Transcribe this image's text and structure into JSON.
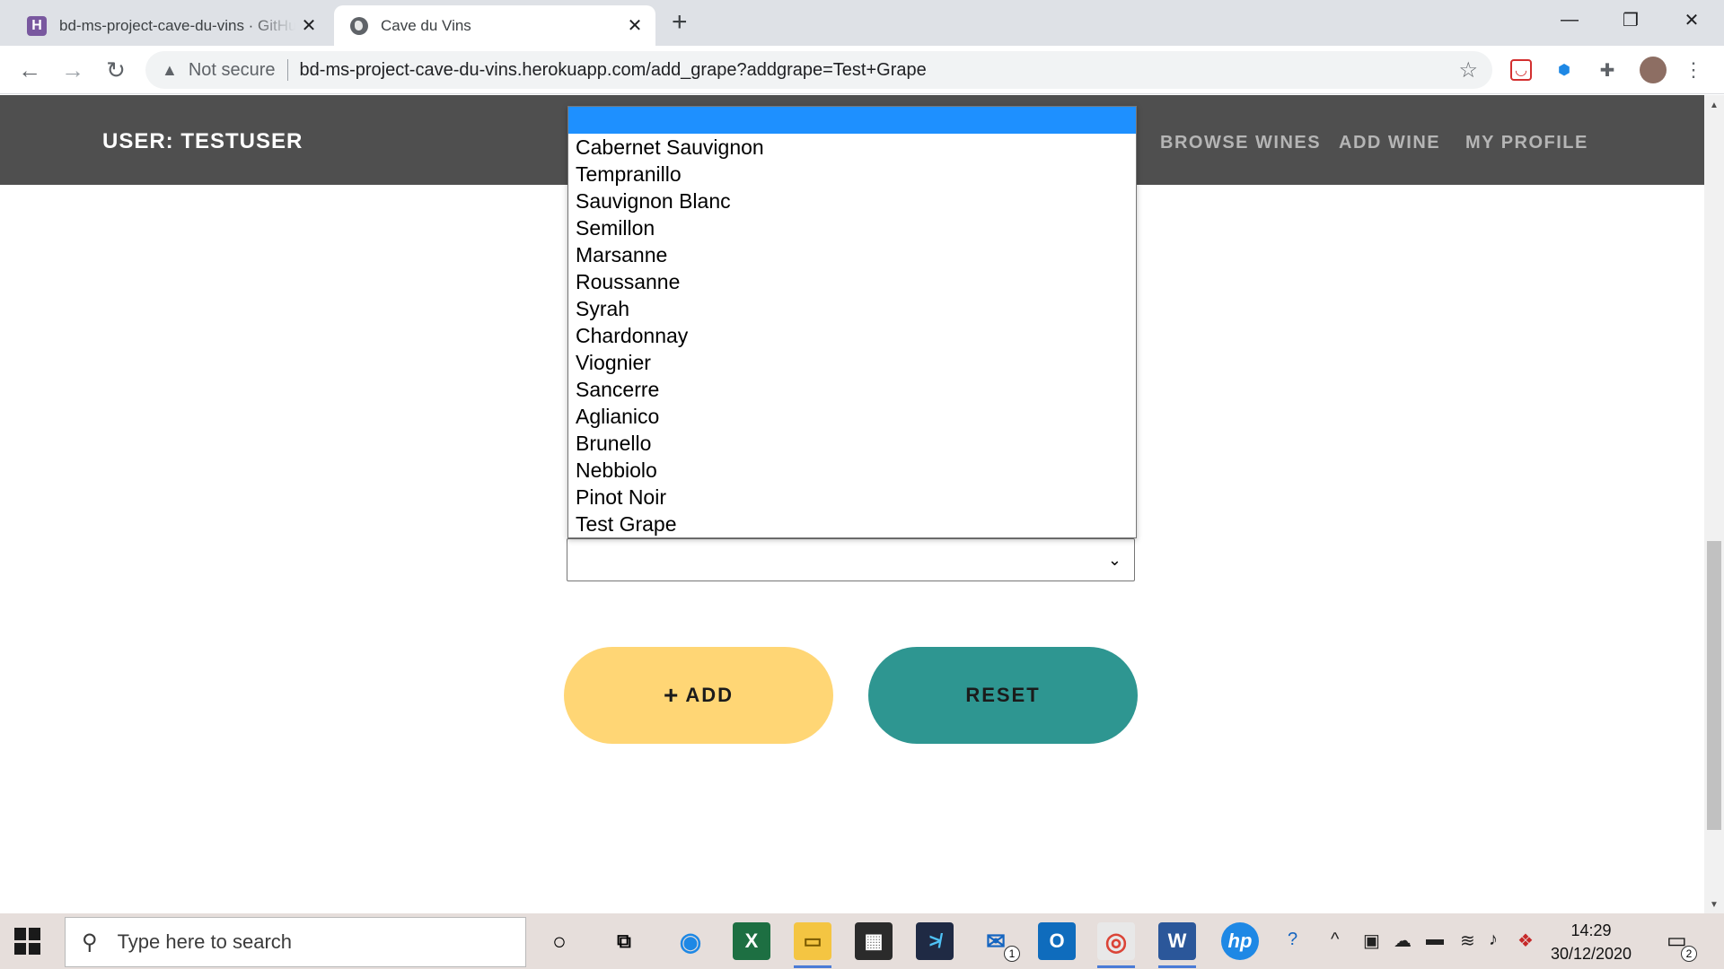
{
  "browser": {
    "tabs": [
      {
        "title": "bd-ms-project-cave-du-vins · GitHub",
        "active": false,
        "favicon": "heroku-icon"
      },
      {
        "title": "Cave du Vins",
        "active": true,
        "favicon": "globe-icon"
      }
    ],
    "security_label": "Not secure",
    "url": "bd-ms-project-cave-du-vins.herokuapp.com/add_grape?addgrape=Test+Grape"
  },
  "navbar": {
    "user": "USER: TESTUSER",
    "links": [
      "BROWSE WINES",
      "ADD WINE",
      "MY PROFILE"
    ]
  },
  "grape_select": {
    "selected": "",
    "options": [
      "",
      "Cabernet Sauvignon",
      "Tempranillo",
      "Sauvignon Blanc",
      "Semillon",
      "Marsanne",
      "Roussanne",
      "Syrah",
      "Chardonnay",
      "Viognier",
      "Sancerre",
      "Aglianico",
      "Brunello",
      "Nebbiolo",
      "Pinot Noir",
      "Test Grape"
    ],
    "highlight_color": "#1e90ff"
  },
  "buttons": {
    "add_label": "ADD",
    "add_icon": "+",
    "reset_label": "RESET",
    "add_color": "#ffd675",
    "reset_color": "#2e9691"
  },
  "taskbar": {
    "search_placeholder": "Type here to search",
    "time": "14:29",
    "date": "30/12/2020",
    "mail_badge": "1",
    "notification_badge": "2"
  }
}
